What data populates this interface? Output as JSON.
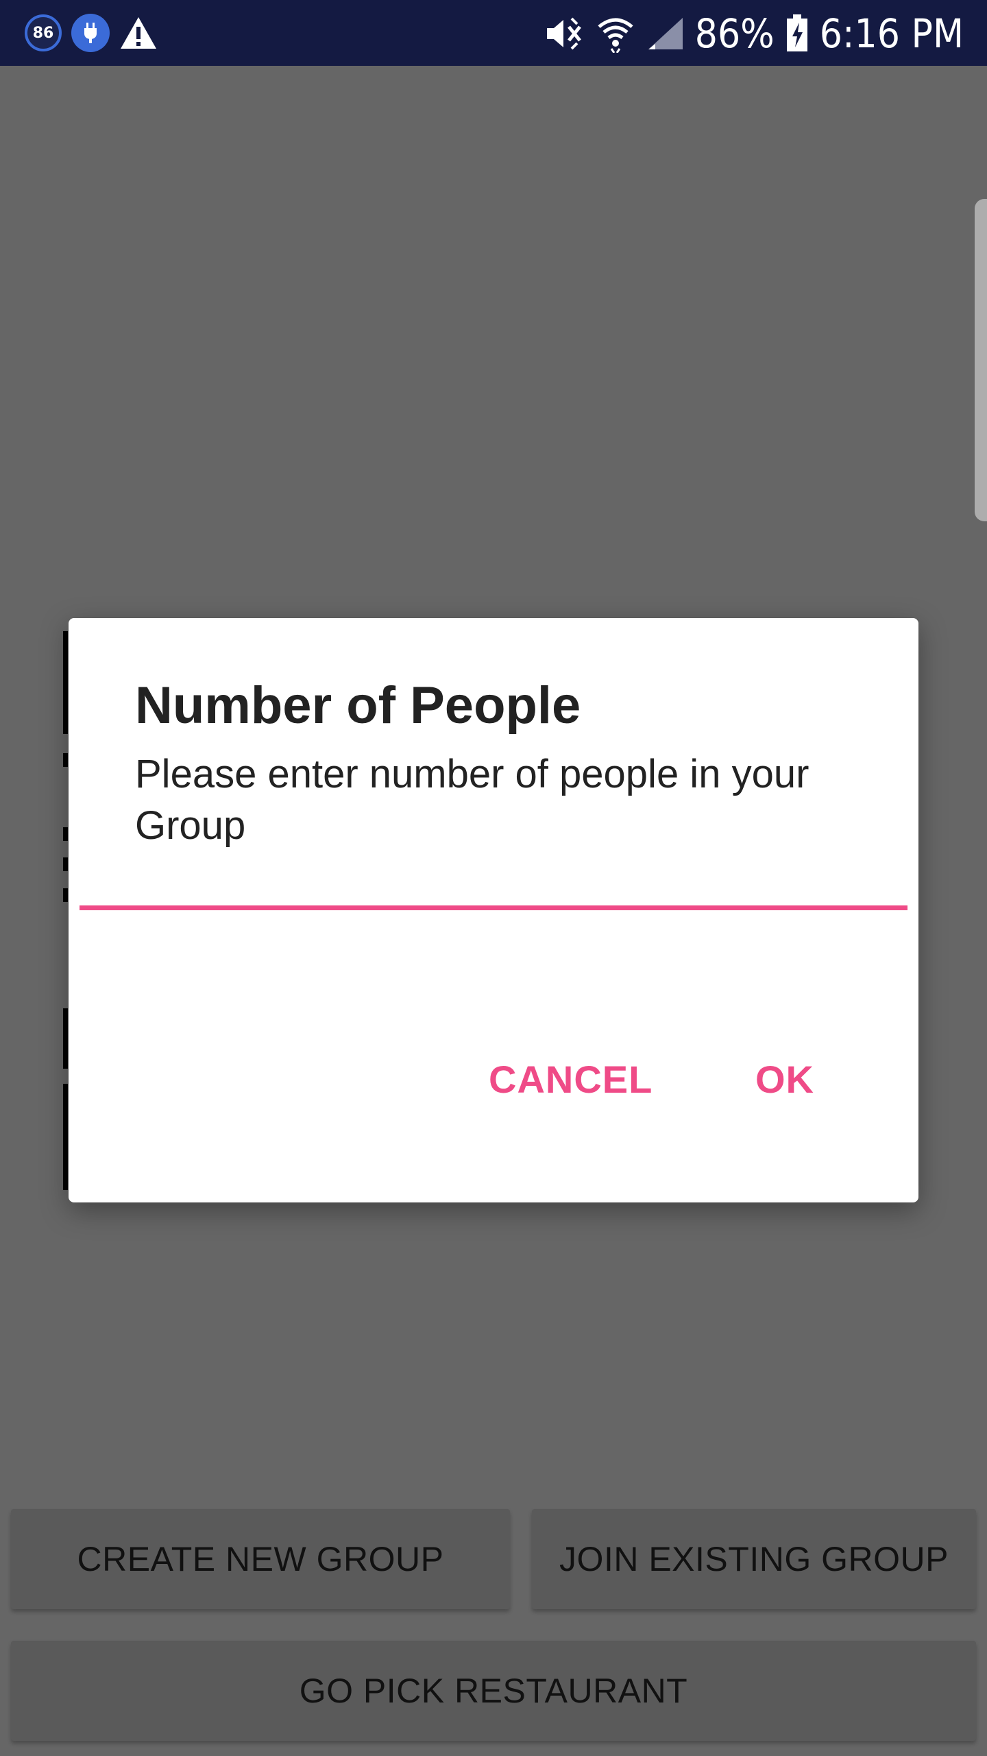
{
  "status_bar": {
    "badge_number": "86",
    "battery_percent": "86%",
    "time": "6:16 PM",
    "icons": [
      "number-badge-icon",
      "plug-icon",
      "warning-icon",
      "mute-icon",
      "wifi-icon",
      "signal-icon",
      "battery-charging-icon"
    ]
  },
  "buttons": {
    "create_group": "CREATE NEW GROUP",
    "join_group": "JOIN EXISTING GROUP",
    "pick_restaurant": "GO PICK RESTAURANT"
  },
  "dialog": {
    "title": "Number of People",
    "message": "Please enter number of people in your Group",
    "input_value": "",
    "cancel_label": "CANCEL",
    "ok_label": "OK"
  },
  "colors": {
    "accent": "#ef4b87",
    "status_bar": "#141a42",
    "scrim": "#666666"
  }
}
